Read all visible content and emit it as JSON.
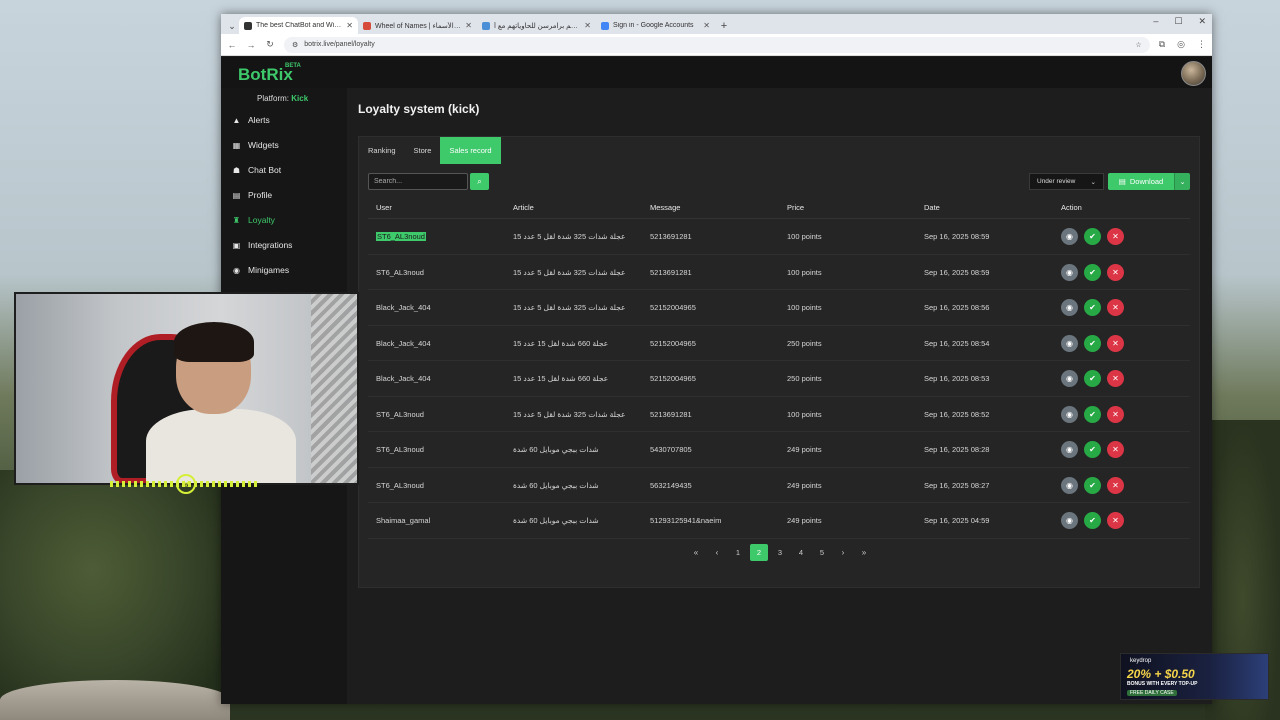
{
  "browser": {
    "tabs": [
      {
        "label": "The best ChatBot and Widgets",
        "favicon_color": "#333333",
        "active": true
      },
      {
        "label": "Wheel of Names | عجلة الأسماء",
        "favicon_color": "#d64b3b",
        "active": false
      },
      {
        "label": "مهاجم برامرسن للحاوياتهم مع أ..",
        "favicon_color": "#4b8fd6",
        "active": false
      },
      {
        "label": "Sign in - Google Accounts",
        "favicon_color": "#4285f4",
        "active": false
      }
    ],
    "new_tab": "+",
    "url": "botrix.live/panel/loyalty"
  },
  "app": {
    "logo": "BotRix",
    "logo_badge": "BETA",
    "platform_label": "Platform:",
    "platform_value": "Kick",
    "sidebar": [
      {
        "label": "Alerts",
        "icon": "warning-icon",
        "glyph": "▲"
      },
      {
        "label": "Widgets",
        "icon": "grid-icon",
        "glyph": "▦"
      },
      {
        "label": "Chat Bot",
        "icon": "robot-icon",
        "glyph": "☗"
      },
      {
        "label": "Profile",
        "icon": "id-card-icon",
        "glyph": "▤"
      },
      {
        "label": "Loyalty",
        "icon": "trophy-icon",
        "glyph": "♜",
        "active": true
      },
      {
        "label": "Integrations",
        "icon": "integrations-icon",
        "glyph": "▣"
      },
      {
        "label": "Minigames",
        "icon": "gamepad-icon",
        "glyph": "◉"
      }
    ],
    "page_title": "Loyalty system (kick)",
    "panel_tabs": [
      {
        "label": "Ranking"
      },
      {
        "label": "Store"
      },
      {
        "label": "Sales record",
        "active": true
      }
    ],
    "search_placeholder": "Search...",
    "status_filter": "Under review",
    "download_label": "Download",
    "columns": [
      "User",
      "Article",
      "Message",
      "Price",
      "Date",
      "Action"
    ],
    "rows": [
      {
        "user": "ST6_AL3noud",
        "article": "عجلة شدات 325 شدة لقل 5 عدد 15",
        "message": "5213691281",
        "price": "100 points",
        "date": "Sep 16, 2025 08:59",
        "selected": true
      },
      {
        "user": "ST6_AL3noud",
        "article": "عجلة شدات 325 شدة لقل 5 عدد 15",
        "message": "5213691281",
        "price": "100 points",
        "date": "Sep 16, 2025 08:59"
      },
      {
        "user": "Black_Jack_404",
        "article": "عجلة شدات 325 شدة لقل 5 عدد 15",
        "message": "52152004965",
        "price": "100 points",
        "date": "Sep 16, 2025 08:56"
      },
      {
        "user": "Black_Jack_404",
        "article": "عجلة 660 شدة لقل 15 عدد 15",
        "message": "52152004965",
        "price": "250 points",
        "date": "Sep 16, 2025 08:54"
      },
      {
        "user": "Black_Jack_404",
        "article": "عجلة 660 شدة لقل 15 عدد 15",
        "message": "52152004965",
        "price": "250 points",
        "date": "Sep 16, 2025 08:53"
      },
      {
        "user": "ST6_AL3noud",
        "article": "عجلة شدات 325 شدة لقل 5 عدد 15",
        "message": "5213691281",
        "price": "100 points",
        "date": "Sep 16, 2025 08:52"
      },
      {
        "user": "ST6_AL3noud",
        "article": "شدات ببجي موبايل 60 شدة",
        "message": "5430707805",
        "price": "249 points",
        "date": "Sep 16, 2025 08:28"
      },
      {
        "user": "ST6_AL3noud",
        "article": "شدات ببجي موبايل 60 شدة",
        "message": "5632149435",
        "price": "249 points",
        "date": "Sep 16, 2025 08:27"
      },
      {
        "user": "Shaimaa_gamal",
        "article": "شدات ببجي موبايل 60 شدة",
        "message": "51293125941&naeim",
        "price": "249 points",
        "date": "Sep 16, 2025 04:59"
      }
    ],
    "pagination": {
      "pages": [
        "1",
        "2",
        "3",
        "4",
        "5"
      ],
      "current": "2",
      "first": "«",
      "prev": "‹",
      "next": "›",
      "last": "»"
    }
  },
  "ad": {
    "brand": "keydrop",
    "promo": "20% + $0.50",
    "sub": "BONUS WITH EVERY TOP-UP",
    "tag": "FREE DAILY CASE"
  },
  "colors": {
    "accent": "#3ec96b",
    "danger": "#dc3545",
    "neutral": "#6b757d"
  }
}
